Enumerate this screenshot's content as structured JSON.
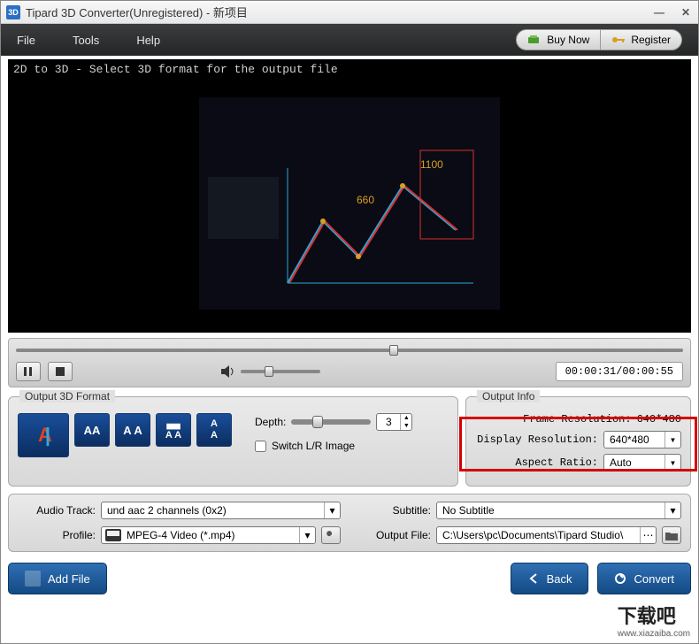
{
  "titlebar": {
    "title": "Tipard 3D Converter(Unregistered) - 新项目"
  },
  "menu": {
    "file": "File",
    "tools": "Tools",
    "help": "Help",
    "buy": "Buy Now",
    "register": "Register"
  },
  "preview": {
    "hint": "2D to 3D - Select 3D format for the output file"
  },
  "playback": {
    "time": "00:00:31/00:00:55"
  },
  "format": {
    "legend": "Output 3D Format",
    "depth_label": "Depth:",
    "depth_value": "3",
    "switch_label": "Switch L/R Image"
  },
  "info": {
    "legend": "Output Info",
    "frame_label": "Frame Resolution:",
    "frame_value": "640*480",
    "disp_label": "Display Resolution:",
    "disp_value": "640*480",
    "aspect_label": "Aspect Ratio:",
    "aspect_value": "Auto"
  },
  "settings": {
    "audio_label": "Audio Track:",
    "audio_value": "und aac 2 channels (0x2)",
    "subtitle_label": "Subtitle:",
    "subtitle_value": "No Subtitle",
    "profile_label": "Profile:",
    "profile_value": "MPEG-4 Video (*.mp4)",
    "output_label": "Output File:",
    "output_value": "C:\\Users\\pc\\Documents\\Tipard Studio\\"
  },
  "buttons": {
    "add": "Add File",
    "back": "Back",
    "convert": "Convert"
  },
  "watermark": {
    "main": "下载吧",
    "sub": "www.xiazaiba.com"
  }
}
